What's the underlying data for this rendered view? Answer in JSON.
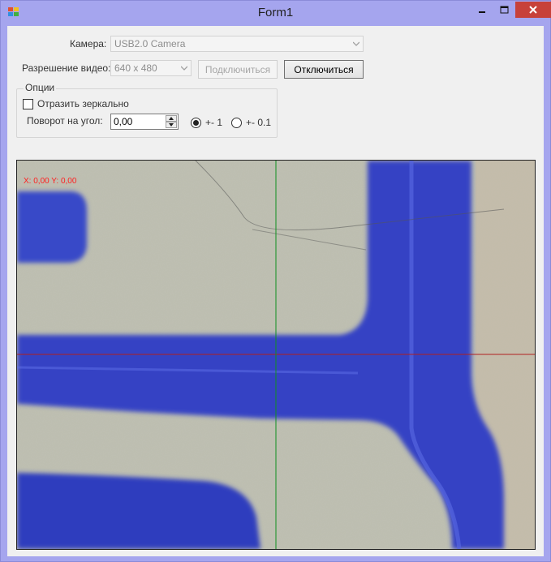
{
  "window": {
    "title": "Form1"
  },
  "camera": {
    "label": "Камера:",
    "value": "USB2.0 Camera"
  },
  "resolution": {
    "label": "Разрешение видео:",
    "value": "640 x 480"
  },
  "buttons": {
    "connect": "Подключиться",
    "disconnect": "Отключиться"
  },
  "options": {
    "group_title": "Опции",
    "mirror_label": "Отразить зеркально",
    "mirror_checked": false,
    "rotate_label": "Поворот на угол:",
    "rotate_value": "0,00",
    "step_1_label": "+- 1",
    "step_01_label": "+- 0.1",
    "selected_step": "+- 1"
  },
  "video": {
    "coords_text": "X: 0,00 Y: 0,00",
    "colors": {
      "background": "#b7b8a8",
      "ink": "#3040c8",
      "crosshair_h": "#b02020",
      "crosshair_v": "#109020",
      "coords": "#ff2020"
    }
  },
  "colors": {
    "titlebar": "#a5a5ee",
    "close_button": "#c7413a",
    "client": "#f0f0f0"
  }
}
